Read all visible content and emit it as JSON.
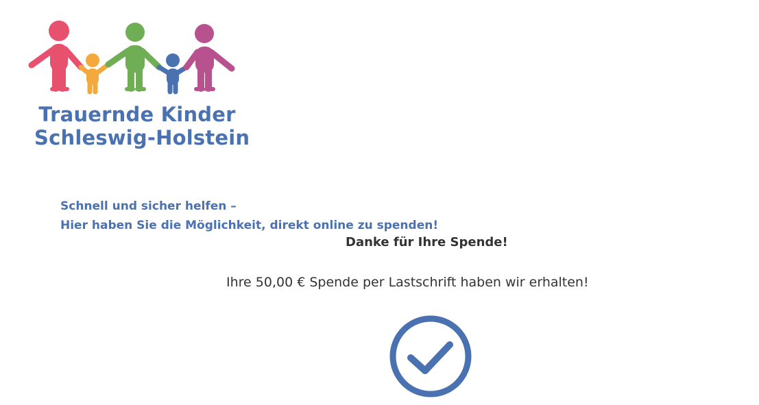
{
  "logo": {
    "line1": "Trauernde Kinder",
    "line2": "Schleswig-Holstein",
    "icon": "family-holding-hands-icon",
    "colors": {
      "pink": "#e8516d",
      "orange": "#f4a93c",
      "green": "#6fae55",
      "blue": "#4a72b0",
      "magenta": "#b8528f"
    }
  },
  "intro": {
    "line1": "Schnell und sicher helfen –",
    "line2": "Hier haben Sie die Möglichkeit, direkt online zu spenden!"
  },
  "confirmation": {
    "title": "Danke für Ihre Spende!",
    "message": "Ihre 50,00 € Spende per Lastschrift haben wir erhalten!",
    "icon": "checkmark-circle-icon",
    "icon_color": "#4a72b0"
  },
  "colors": {
    "brand_blue": "#4a72b0",
    "text": "#333333"
  }
}
